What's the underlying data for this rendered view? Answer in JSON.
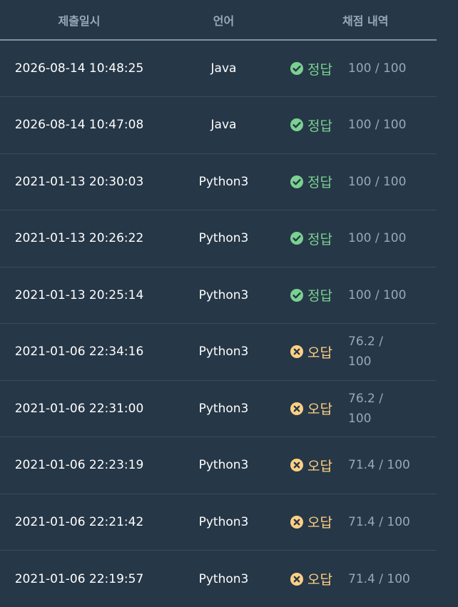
{
  "colors": {
    "background": "#263747",
    "header_text": "#98a8b9",
    "correct": "#7ad190",
    "wrong": "#ffd083",
    "score": "#98a8b9"
  },
  "table": {
    "headers": {
      "date": "제출일시",
      "language": "언어",
      "result": "채점 내역"
    },
    "rows": [
      {
        "date": "2026-08-14 10:48:25",
        "language": "Java",
        "status": "정답",
        "status_type": "correct",
        "score_line1": "100 / 100",
        "score_line2": ""
      },
      {
        "date": "2026-08-14 10:47:08",
        "language": "Java",
        "status": "정답",
        "status_type": "correct",
        "score_line1": "100 / 100",
        "score_line2": ""
      },
      {
        "date": "2021-01-13 20:30:03",
        "language": "Python3",
        "status": "정답",
        "status_type": "correct",
        "score_line1": "100 / 100",
        "score_line2": ""
      },
      {
        "date": "2021-01-13 20:26:22",
        "language": "Python3",
        "status": "정답",
        "status_type": "correct",
        "score_line1": "100 / 100",
        "score_line2": ""
      },
      {
        "date": "2021-01-13 20:25:14",
        "language": "Python3",
        "status": "정답",
        "status_type": "correct",
        "score_line1": "100 / 100",
        "score_line2": ""
      },
      {
        "date": "2021-01-06 22:34:16",
        "language": "Python3",
        "status": "오답",
        "status_type": "wrong",
        "score_line1": "76.2 /",
        "score_line2": "100"
      },
      {
        "date": "2021-01-06 22:31:00",
        "language": "Python3",
        "status": "오답",
        "status_type": "wrong",
        "score_line1": "76.2 /",
        "score_line2": "100"
      },
      {
        "date": "2021-01-06 22:23:19",
        "language": "Python3",
        "status": "오답",
        "status_type": "wrong",
        "score_line1": "71.4 / 100",
        "score_line2": ""
      },
      {
        "date": "2021-01-06 22:21:42",
        "language": "Python3",
        "status": "오답",
        "status_type": "wrong",
        "score_line1": "71.4 / 100",
        "score_line2": ""
      },
      {
        "date": "2021-01-06 22:19:57",
        "language": "Python3",
        "status": "오답",
        "status_type": "wrong",
        "score_line1": "71.4 / 100",
        "score_line2": ""
      }
    ]
  }
}
